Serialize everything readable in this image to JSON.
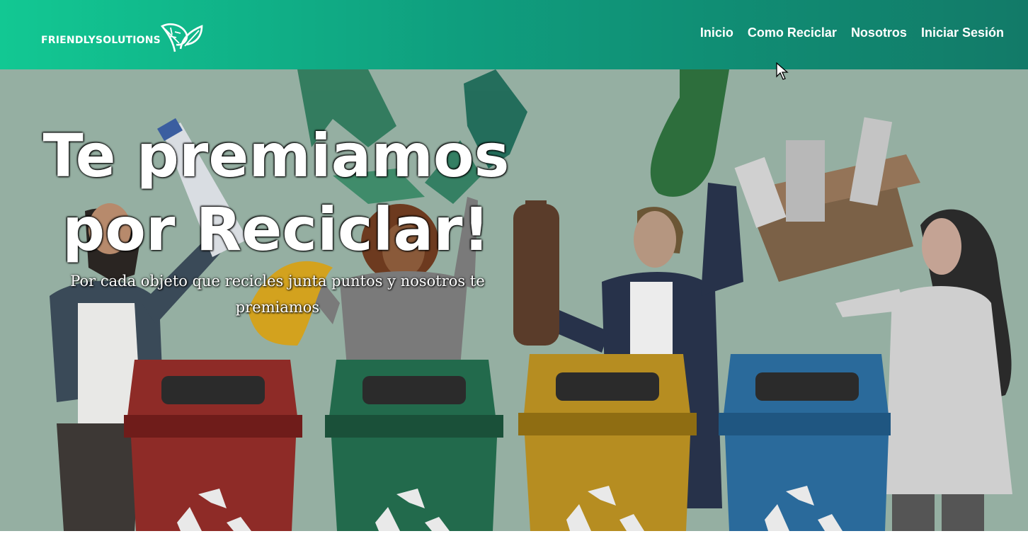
{
  "brand": {
    "name": "FRIENDLYSOLUTIONS",
    "logo_icon": "leaves-icon"
  },
  "nav": {
    "items": [
      {
        "label": "Inicio"
      },
      {
        "label": "Como Reciclar"
      },
      {
        "label": "Nosotros"
      },
      {
        "label": "Iniciar Sesión"
      }
    ]
  },
  "hero": {
    "title_line1": "Te premiamos",
    "title_line2": "por Reciclar!",
    "subtitle": "Por cada objeto que recicles junta puntos y nosotros te premiamos",
    "illustration": "people-recycling-bins-illustration"
  },
  "colors": {
    "nav_gradient_start": "#12c893",
    "nav_gradient_end": "#127a68",
    "hero_background": "#95afa2",
    "bin_red": "#8e2b27",
    "bin_green": "#226a4c",
    "bin_yellow": "#b68d21",
    "bin_blue": "#2a6a9b"
  }
}
